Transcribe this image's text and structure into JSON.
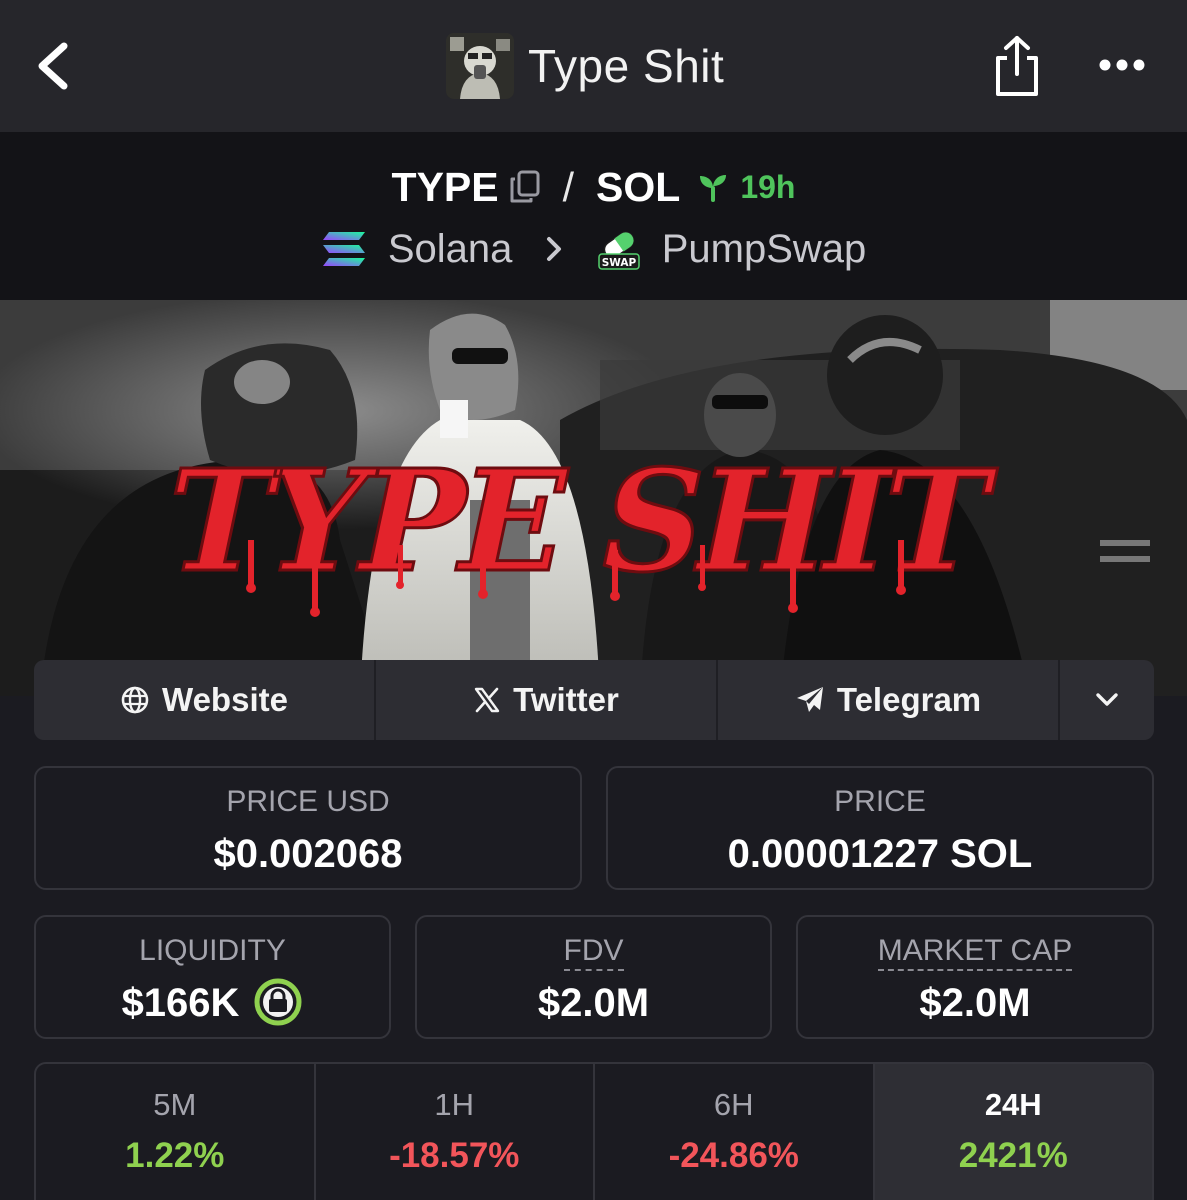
{
  "header": {
    "title": "Type Shit",
    "icons": {
      "back": "back-chevron-icon",
      "share": "share-icon",
      "more": "more-dots-icon"
    }
  },
  "pair": {
    "base": "TYPE",
    "quote": "SOL",
    "separator": "/",
    "age": "19h",
    "chain": "Solana",
    "dex": "PumpSwap",
    "dex_badge": "SWAP"
  },
  "banner": {
    "graffiti_text": "TYPE SHIT"
  },
  "links": [
    {
      "label": "Website",
      "icon": "globe-icon"
    },
    {
      "label": "Twitter",
      "icon": "x-logo-icon"
    },
    {
      "label": "Telegram",
      "icon": "telegram-icon"
    }
  ],
  "stats": {
    "price_usd": {
      "label": "PRICE USD",
      "value": "$0.002068"
    },
    "price": {
      "label": "PRICE",
      "value": "0.00001227 SOL"
    },
    "liquidity": {
      "label": "LIQUIDITY",
      "value": "$166K"
    },
    "fdv": {
      "label": "FDV",
      "value": "$2.0M"
    },
    "market_cap": {
      "label": "MARKET CAP",
      "value": "$2.0M"
    }
  },
  "changes": [
    {
      "label": "5M",
      "value": "1.22%"
    },
    {
      "label": "1H",
      "value": "-18.57%"
    },
    {
      "label": "6H",
      "value": "-24.86%"
    },
    {
      "label": "24H",
      "value": "2421%"
    }
  ],
  "colors": {
    "positive": "#8fd14f",
    "negative": "#f2555a",
    "age_green": "#4fc45c",
    "graffiti_red": "#e3232b",
    "lock_green": "#8fd14f"
  }
}
